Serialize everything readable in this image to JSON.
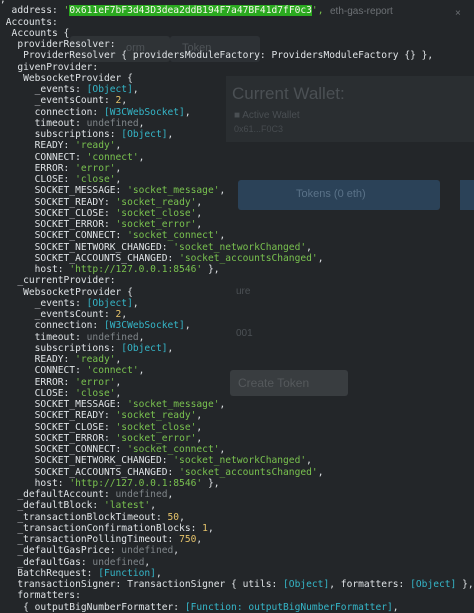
{
  "background_page": {
    "tab_title": "eth-gas-report",
    "tab_close": "×",
    "field1_text": "orm",
    "field2_text": "Token",
    "wallet_title": "Current Wallet:",
    "wallet_sub": "■ Active Wallet",
    "wallet_addr": "0x61...F0C3",
    "btn1_text": "Tokens (0 eth)",
    "label1": "ure",
    "label2": "001",
    "create_token": "Create Token"
  },
  "console": {
    "lines": [
      [
        {
          "t": ",",
          "c": "txt"
        }
      ],
      [
        {
          "t": "  address: ",
          "c": "txt"
        },
        {
          "t": "'",
          "c": "str"
        },
        {
          "t": "0x611eF7bF3d43D3dea2ddB194F7a47BF41d7fF0c3",
          "c": "hl"
        },
        {
          "t": "',",
          "c": "str"
        }
      ],
      [
        {
          "t": " Accounts:",
          "c": "txt"
        }
      ],
      [
        {
          "t": "  Accounts {",
          "c": "txt"
        }
      ],
      [
        {
          "t": "   providerResolver:",
          "c": "txt"
        }
      ],
      [
        {
          "t": "    ProviderResolver { providersModuleFactory: ProvidersModuleFactory {} },",
          "c": "txt"
        }
      ],
      [
        {
          "t": "   givenProvider:",
          "c": "txt"
        }
      ],
      [
        {
          "t": "    WebsocketProvider {",
          "c": "txt"
        }
      ],
      [
        {
          "t": "      _events: ",
          "c": "txt"
        },
        {
          "t": "[Object]",
          "c": "obj"
        },
        {
          "t": ",",
          "c": "txt"
        }
      ],
      [
        {
          "t": "      _eventsCount: ",
          "c": "txt"
        },
        {
          "t": "2",
          "c": "num"
        },
        {
          "t": ",",
          "c": "txt"
        }
      ],
      [
        {
          "t": "      connection: ",
          "c": "txt"
        },
        {
          "t": "[W3CWebSocket]",
          "c": "obj"
        },
        {
          "t": ",",
          "c": "txt"
        }
      ],
      [
        {
          "t": "      timeout: ",
          "c": "txt"
        },
        {
          "t": "undefined",
          "c": "undef"
        },
        {
          "t": ",",
          "c": "txt"
        }
      ],
      [
        {
          "t": "      subscriptions: ",
          "c": "txt"
        },
        {
          "t": "[Object]",
          "c": "obj"
        },
        {
          "t": ",",
          "c": "txt"
        }
      ],
      [
        {
          "t": "      READY: ",
          "c": "txt"
        },
        {
          "t": "'ready'",
          "c": "str"
        },
        {
          "t": ",",
          "c": "txt"
        }
      ],
      [
        {
          "t": "      CONNECT: ",
          "c": "txt"
        },
        {
          "t": "'connect'",
          "c": "str"
        },
        {
          "t": ",",
          "c": "txt"
        }
      ],
      [
        {
          "t": "      ERROR: ",
          "c": "txt"
        },
        {
          "t": "'error'",
          "c": "str"
        },
        {
          "t": ",",
          "c": "txt"
        }
      ],
      [
        {
          "t": "      CLOSE: ",
          "c": "txt"
        },
        {
          "t": "'close'",
          "c": "str"
        },
        {
          "t": ",",
          "c": "txt"
        }
      ],
      [
        {
          "t": "      SOCKET_MESSAGE: ",
          "c": "txt"
        },
        {
          "t": "'socket_message'",
          "c": "str"
        },
        {
          "t": ",",
          "c": "txt"
        }
      ],
      [
        {
          "t": "      SOCKET_READY: ",
          "c": "txt"
        },
        {
          "t": "'socket_ready'",
          "c": "str"
        },
        {
          "t": ",",
          "c": "txt"
        }
      ],
      [
        {
          "t": "      SOCKET_CLOSE: ",
          "c": "txt"
        },
        {
          "t": "'socket_close'",
          "c": "str"
        },
        {
          "t": ",",
          "c": "txt"
        }
      ],
      [
        {
          "t": "      SOCKET_ERROR: ",
          "c": "txt"
        },
        {
          "t": "'socket_error'",
          "c": "str"
        },
        {
          "t": ",",
          "c": "txt"
        }
      ],
      [
        {
          "t": "      SOCKET_CONNECT: ",
          "c": "txt"
        },
        {
          "t": "'socket_connect'",
          "c": "str"
        },
        {
          "t": ",",
          "c": "txt"
        }
      ],
      [
        {
          "t": "      SOCKET_NETWORK_CHANGED: ",
          "c": "txt"
        },
        {
          "t": "'socket_networkChanged'",
          "c": "str"
        },
        {
          "t": ",",
          "c": "txt"
        }
      ],
      [
        {
          "t": "      SOCKET_ACCOUNTS_CHANGED: ",
          "c": "txt"
        },
        {
          "t": "'socket_accountsChanged'",
          "c": "str"
        },
        {
          "t": ",",
          "c": "txt"
        }
      ],
      [
        {
          "t": "      host: ",
          "c": "txt"
        },
        {
          "t": "'http://127.0.0.1:8546'",
          "c": "str"
        },
        {
          "t": " },",
          "c": "txt"
        }
      ],
      [
        {
          "t": "   _currentProvider:",
          "c": "txt"
        }
      ],
      [
        {
          "t": "    WebsocketProvider {",
          "c": "txt"
        }
      ],
      [
        {
          "t": "      _events: ",
          "c": "txt"
        },
        {
          "t": "[Object]",
          "c": "obj"
        },
        {
          "t": ",",
          "c": "txt"
        }
      ],
      [
        {
          "t": "      _eventsCount: ",
          "c": "txt"
        },
        {
          "t": "2",
          "c": "num"
        },
        {
          "t": ",",
          "c": "txt"
        }
      ],
      [
        {
          "t": "      connection: ",
          "c": "txt"
        },
        {
          "t": "[W3CWebSocket]",
          "c": "obj"
        },
        {
          "t": ",",
          "c": "txt"
        }
      ],
      [
        {
          "t": "      timeout: ",
          "c": "txt"
        },
        {
          "t": "undefined",
          "c": "undef"
        },
        {
          "t": ",",
          "c": "txt"
        }
      ],
      [
        {
          "t": "      subscriptions: ",
          "c": "txt"
        },
        {
          "t": "[Object]",
          "c": "obj"
        },
        {
          "t": ",",
          "c": "txt"
        }
      ],
      [
        {
          "t": "      READY: ",
          "c": "txt"
        },
        {
          "t": "'ready'",
          "c": "str"
        },
        {
          "t": ",",
          "c": "txt"
        }
      ],
      [
        {
          "t": "      CONNECT: ",
          "c": "txt"
        },
        {
          "t": "'connect'",
          "c": "str"
        },
        {
          "t": ",",
          "c": "txt"
        }
      ],
      [
        {
          "t": "      ERROR: ",
          "c": "txt"
        },
        {
          "t": "'error'",
          "c": "str"
        },
        {
          "t": ",",
          "c": "txt"
        }
      ],
      [
        {
          "t": "      CLOSE: ",
          "c": "txt"
        },
        {
          "t": "'close'",
          "c": "str"
        },
        {
          "t": ",",
          "c": "txt"
        }
      ],
      [
        {
          "t": "      SOCKET_MESSAGE: ",
          "c": "txt"
        },
        {
          "t": "'socket_message'",
          "c": "str"
        },
        {
          "t": ",",
          "c": "txt"
        }
      ],
      [
        {
          "t": "      SOCKET_READY: ",
          "c": "txt"
        },
        {
          "t": "'socket_ready'",
          "c": "str"
        },
        {
          "t": ",",
          "c": "txt"
        }
      ],
      [
        {
          "t": "      SOCKET_CLOSE: ",
          "c": "txt"
        },
        {
          "t": "'socket_close'",
          "c": "str"
        },
        {
          "t": ",",
          "c": "txt"
        }
      ],
      [
        {
          "t": "      SOCKET_ERROR: ",
          "c": "txt"
        },
        {
          "t": "'socket_error'",
          "c": "str"
        },
        {
          "t": ",",
          "c": "txt"
        }
      ],
      [
        {
          "t": "      SOCKET_CONNECT: ",
          "c": "txt"
        },
        {
          "t": "'socket_connect'",
          "c": "str"
        },
        {
          "t": ",",
          "c": "txt"
        }
      ],
      [
        {
          "t": "      SOCKET_NETWORK_CHANGED: ",
          "c": "txt"
        },
        {
          "t": "'socket_networkChanged'",
          "c": "str"
        },
        {
          "t": ",",
          "c": "txt"
        }
      ],
      [
        {
          "t": "      SOCKET_ACCOUNTS_CHANGED: ",
          "c": "txt"
        },
        {
          "t": "'socket_accountsChanged'",
          "c": "str"
        },
        {
          "t": ",",
          "c": "txt"
        }
      ],
      [
        {
          "t": "      host: ",
          "c": "txt"
        },
        {
          "t": "'http://127.0.0.1:8546'",
          "c": "str"
        },
        {
          "t": " },",
          "c": "txt"
        }
      ],
      [
        {
          "t": "   _defaultAccount: ",
          "c": "txt"
        },
        {
          "t": "undefined",
          "c": "undef"
        },
        {
          "t": ",",
          "c": "txt"
        }
      ],
      [
        {
          "t": "   _defaultBlock: ",
          "c": "txt"
        },
        {
          "t": "'latest'",
          "c": "str"
        },
        {
          "t": ",",
          "c": "txt"
        }
      ],
      [
        {
          "t": "   _transactionBlockTimeout: ",
          "c": "txt"
        },
        {
          "t": "50",
          "c": "num"
        },
        {
          "t": ",",
          "c": "txt"
        }
      ],
      [
        {
          "t": "   _transactionConfirmationBlocks: ",
          "c": "txt"
        },
        {
          "t": "1",
          "c": "num"
        },
        {
          "t": ",",
          "c": "txt"
        }
      ],
      [
        {
          "t": "   _transactionPollingTimeout: ",
          "c": "txt"
        },
        {
          "t": "750",
          "c": "num"
        },
        {
          "t": ",",
          "c": "txt"
        }
      ],
      [
        {
          "t": "   _defaultGasPrice: ",
          "c": "txt"
        },
        {
          "t": "undefined",
          "c": "undef"
        },
        {
          "t": ",",
          "c": "txt"
        }
      ],
      [
        {
          "t": "   _defaultGas: ",
          "c": "txt"
        },
        {
          "t": "undefined",
          "c": "undef"
        },
        {
          "t": ",",
          "c": "txt"
        }
      ],
      [
        {
          "t": "   BatchRequest: ",
          "c": "txt"
        },
        {
          "t": "[Function]",
          "c": "obj"
        },
        {
          "t": ",",
          "c": "txt"
        }
      ],
      [
        {
          "t": "   transactionSigner: TransactionSigner { utils: ",
          "c": "txt"
        },
        {
          "t": "[Object]",
          "c": "obj"
        },
        {
          "t": ", formatters: ",
          "c": "txt"
        },
        {
          "t": "[Object]",
          "c": "obj"
        },
        {
          "t": " },",
          "c": "txt"
        }
      ],
      [
        {
          "t": "   formatters:",
          "c": "txt"
        }
      ],
      [
        {
          "t": "    { outputBigNumberFormatter: ",
          "c": "txt"
        },
        {
          "t": "[Function: outputBigNumberFormatter]",
          "c": "obj"
        },
        {
          "t": ",",
          "c": "txt"
        }
      ]
    ]
  }
}
